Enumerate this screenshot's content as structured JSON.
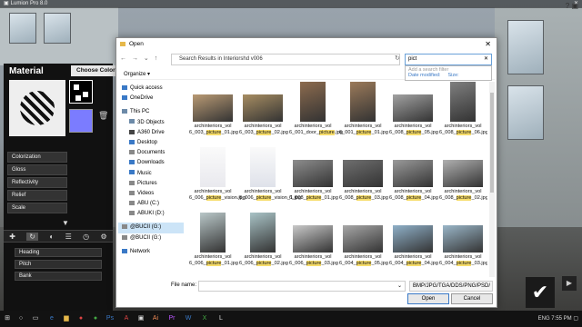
{
  "app": {
    "title": "Lumion Pro 8.0"
  },
  "material_panel": {
    "title": "Material",
    "choose_color": "Choose Color",
    "properties": [
      "Colorization",
      "Gloss",
      "Reflectivity",
      "Relief",
      "Scale"
    ],
    "rotation": [
      "Heading",
      "Pitch",
      "Bank"
    ]
  },
  "dialog": {
    "title": "Open",
    "address": "Search Results in Interiorshd v006",
    "search_value": "pict",
    "organize": "Organize",
    "tooltip": {
      "add_filter": "Add a search filter",
      "date_modified": "Date modified:",
      "size": "Size:"
    },
    "nav": [
      {
        "label": "Quick access",
        "color": "#3a79c6"
      },
      {
        "label": "OneDrive",
        "color": "#3a79c6"
      },
      {
        "label": "This PC",
        "color": "#6c8aa8"
      },
      {
        "label": "3D Objects",
        "color": "#6c8aa8"
      },
      {
        "label": "A360 Drive",
        "color": "#444"
      },
      {
        "label": "Desktop",
        "color": "#3a79c6"
      },
      {
        "label": "Documents",
        "color": "#888"
      },
      {
        "label": "Downloads",
        "color": "#3a79c6"
      },
      {
        "label": "Music",
        "color": "#3a79c6"
      },
      {
        "label": "Pictures",
        "color": "#888"
      },
      {
        "label": "Videos",
        "color": "#888"
      },
      {
        "label": "ABU (C:)",
        "color": "#888"
      },
      {
        "label": "ABUKI (D:)",
        "color": "#888"
      },
      {
        "label": "@BUCII (G:)",
        "color": "#888"
      },
      {
        "label": "@BUCII (G:)",
        "color": "#888"
      },
      {
        "label": "Network",
        "color": "#3a79c6"
      }
    ],
    "files": [
      {
        "l1": "archinteriors_vol",
        "l2": "6_003_",
        "hl": "picture",
        "l3": "_01.jpg",
        "tone": "#b99a74"
      },
      {
        "l1": "archinteriors_vol",
        "l2": "6_003_",
        "hl": "picture",
        "l3": "_02.jpg",
        "tone": "#a78d62"
      },
      {
        "l1": "archinteriors_vol",
        "l2": "6_001_door_",
        "hl": "picture",
        "l3": ".jpg",
        "tone": "#8c6b4e"
      },
      {
        "l1": "archinteriors_vol",
        "l2": "6_001_",
        "hl": "picture",
        "l3": "_01.jpg",
        "tone": "#9b7a5a"
      },
      {
        "l1": "archinteriors_vol",
        "l2": "6_008_",
        "hl": "picture",
        "l3": "_05.jpg",
        "tone": "#a2a2a2"
      },
      {
        "l1": "archinteriors_vol",
        "l2": "6_008_",
        "hl": "picture",
        "l3": "_06.jpg",
        "tone": "#7f7f7f"
      },
      {
        "l1": "archinteriors_vol",
        "l2": "6_006_",
        "hl": "picture",
        "l3": "_vision.jpg",
        "tone": "#e9e9ee"
      },
      {
        "l1": "archinteriors_vol",
        "l2": "6_006_",
        "hl": "picture",
        "l3": "_vision_1.jpg",
        "tone": "#dfe2ea"
      },
      {
        "l1": "archinteriors_vol",
        "l2": "6_008_",
        "hl": "picture",
        "l3": "_01.jpg",
        "tone": "#8d8d8d"
      },
      {
        "l1": "archinteriors_vol",
        "l2": "6_008_",
        "hl": "picture",
        "l3": "_03.jpg",
        "tone": "#6f6f6f"
      },
      {
        "l1": "archinteriors_vol",
        "l2": "6_008_",
        "hl": "picture",
        "l3": "_04.jpg",
        "tone": "#9a9a9a"
      },
      {
        "l1": "archinteriors_vol",
        "l2": "6_008_",
        "hl": "picture",
        "l3": "_02.jpg",
        "tone": "#b0b0b0"
      },
      {
        "l1": "archinteriors_vol",
        "l2": "6_006_",
        "hl": "picture",
        "l3": "_01.jpg",
        "tone": "#b9c7c8"
      },
      {
        "l1": "archinteriors_vol",
        "l2": "6_006_",
        "hl": "picture",
        "l3": "_02.jpg",
        "tone": "#a9c3c6"
      },
      {
        "l1": "archinteriors_vol",
        "l2": "6_006_",
        "hl": "picture",
        "l3": "_03.jpg",
        "tone": "#c9c9c9"
      },
      {
        "l1": "archinteriors_vol",
        "l2": "6_004_",
        "hl": "picture",
        "l3": "_05.jpg",
        "tone": "#a7a7a7"
      },
      {
        "l1": "archinteriors_vol",
        "l2": "6_004_",
        "hl": "picture",
        "l3": "_04.jpg",
        "tone": "#8fb0c8"
      },
      {
        "l1": "archinteriors_vol",
        "l2": "6_004_",
        "hl": "picture",
        "l3": "_03.jpg",
        "tone": "#9ab6c8"
      }
    ],
    "file_name_label": "File name:",
    "file_type": "BMP/JPG/TGA/DDS/PNG/PSD/",
    "open_label": "Open",
    "cancel_label": "Cancel"
  },
  "taskbar": {
    "tray": "ENG  7:55 PM"
  }
}
